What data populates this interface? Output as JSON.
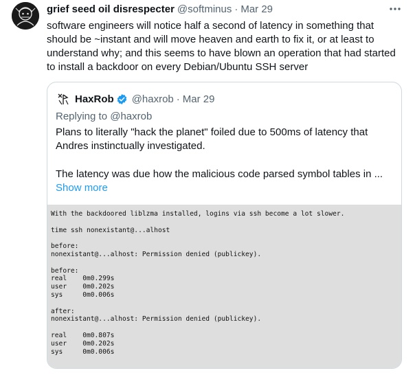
{
  "tweet": {
    "author_name": "grief seed oil disrespecter",
    "author_handle": "@softminus",
    "separator": "·",
    "date": "Mar 29",
    "text": "software engineers will notice half a second of latency in something that should be ~instant and will move heaven and earth to fix it, or at least to understand why; and this seems to have blown an operation that had started to install a backdoor on every Debian/Ubuntu SSH server"
  },
  "quote": {
    "author_name": "HaxRob",
    "author_handle": "@haxrob",
    "separator": "·",
    "date": "Mar 29",
    "replying_prefix": "Replying to",
    "replying_to": "@haxrob",
    "text_line1": "Plans to literally \"hack the planet\" foiled due to 500ms of latency that Andres instinctually investigated.",
    "text_line2": "The latency was due how the malicious code parsed symbol tables in ...",
    "show_more": "Show more",
    "code_lines": [
      "With the backdoored liblzma installed, logins via ssh become a lot slower.",
      "",
      "time ssh nonexistant@...alhost",
      "",
      "before:",
      "nonexistant@...alhost: Permission denied (publickey).",
      "",
      "before:",
      "real    0m0.299s",
      "user    0m0.202s",
      "sys     0m0.006s",
      "",
      "after:",
      "nonexistant@...alhost: Permission denied (publickey).",
      "",
      "real    0m0.807s",
      "user    0m0.202s",
      "sys     0m0.006s"
    ]
  },
  "colors": {
    "text_primary": "#0f1419",
    "text_secondary": "#536471",
    "link": "#1d9bf0",
    "verified": "#1d9bf0",
    "border": "#cfd9de",
    "code_bg": "#dedede"
  },
  "icons": {
    "more": "more-horizontal-icon",
    "verified": "verified-badge-icon"
  }
}
